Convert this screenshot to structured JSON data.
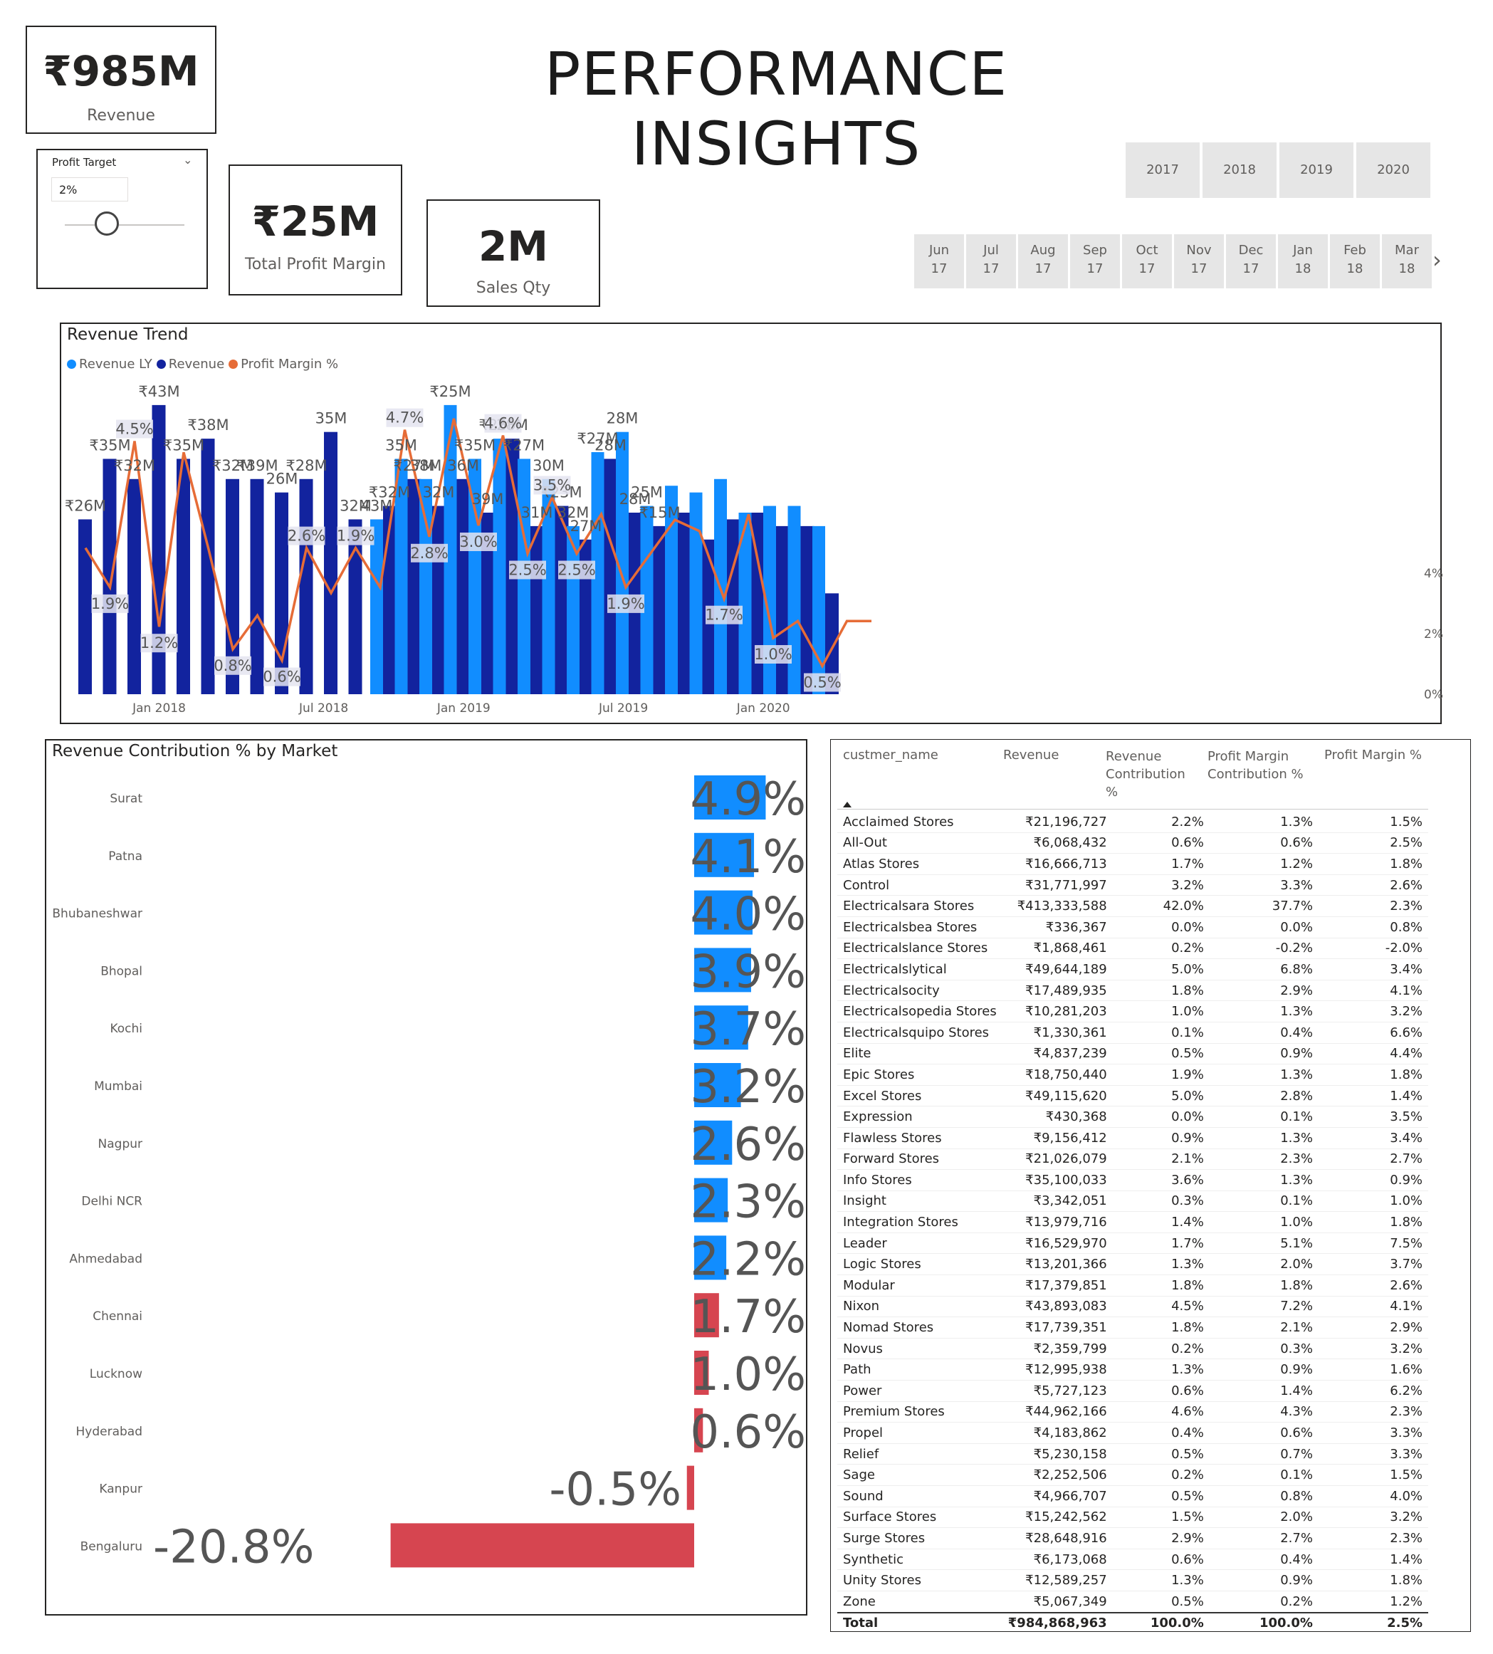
{
  "title": "PERFORMANCE INSIGHTS",
  "kpis": {
    "revenue": {
      "value": "₹985M",
      "label": "Revenue"
    },
    "profit_margin": {
      "value": "₹25M",
      "label": "Total Profit Margin"
    },
    "sales_qty": {
      "value": "2M",
      "label": "Sales Qty"
    }
  },
  "profit_target": {
    "label": "Profit Target",
    "value": "2%",
    "slider_fraction": 0.35
  },
  "year_slicer": [
    "2017",
    "2018",
    "2019",
    "2020"
  ],
  "month_slicer": [
    {
      "m": "Jun",
      "y": "17"
    },
    {
      "m": "Jul",
      "y": "17"
    },
    {
      "m": "Aug",
      "y": "17"
    },
    {
      "m": "Sep",
      "y": "17"
    },
    {
      "m": "Oct",
      "y": "17"
    },
    {
      "m": "Nov",
      "y": "17"
    },
    {
      "m": "Dec",
      "y": "17"
    },
    {
      "m": "Jan",
      "y": "18"
    },
    {
      "m": "Feb",
      "y": "18"
    },
    {
      "m": "Mar",
      "y": "18"
    }
  ],
  "trend": {
    "title": "Revenue Trend",
    "legend": [
      {
        "name": "Revenue LY",
        "color": "#118dff"
      },
      {
        "name": "Revenue",
        "color": "#12239e"
      },
      {
        "name": "Profit Margin %",
        "color": "#e66c37"
      }
    ],
    "x_ticks": [
      "Jan 2018",
      "Jul 2018",
      "Jan 2019",
      "Jul 2019",
      "Jan 2020"
    ],
    "y2_ticks": [
      "4%",
      "2%",
      "0%"
    ]
  },
  "chart_data": [
    {
      "type": "bar+line",
      "title": "Revenue Trend",
      "categories": [
        "2017-10",
        "2017-11",
        "2017-12",
        "2018-01",
        "2018-02",
        "2018-03",
        "2018-04",
        "2018-05",
        "2018-06",
        "2018-07",
        "2018-08",
        "2018-09",
        "2018-10",
        "2018-11",
        "2018-12",
        "2019-01",
        "2019-02",
        "2019-03",
        "2019-04",
        "2019-05",
        "2019-06",
        "2019-07",
        "2019-08",
        "2019-09",
        "2019-10",
        "2019-11",
        "2019-12",
        "2020-01",
        "2020-02",
        "2020-03",
        "2020-04",
        "2020-05",
        "2020-06"
      ],
      "series": [
        {
          "name": "Revenue LY",
          "values": [
            null,
            null,
            null,
            null,
            null,
            null,
            null,
            null,
            null,
            null,
            null,
            null,
            26,
            35,
            32,
            43,
            35,
            38,
            35,
            32,
            25,
            36,
            39,
            28,
            31,
            30,
            32,
            27,
            28,
            28,
            25,
            null,
            null
          ]
        },
        {
          "name": "Revenue",
          "values": [
            26,
            35,
            32,
            43,
            35,
            38,
            32,
            32,
            30,
            32,
            39,
            26,
            28,
            32,
            28,
            32,
            27,
            38,
            25,
            28,
            23,
            35,
            27,
            25,
            27,
            23,
            26,
            27,
            25,
            25,
            15,
            null,
            null
          ]
        },
        {
          "name": "Profit Margin %",
          "values": [
            2.6,
            1.9,
            4.5,
            1.2,
            4.3,
            2.6,
            0.8,
            1.4,
            0.6,
            2.6,
            1.8,
            2.6,
            1.9,
            4.7,
            2.8,
            4.9,
            3.0,
            4.6,
            2.5,
            3.5,
            2.5,
            3.2,
            1.9,
            2.5,
            3.1,
            2.9,
            1.7,
            3.2,
            1.0,
            1.3,
            0.5,
            1.3,
            1.3
          ]
        }
      ],
      "bar_labels": [
        "₹26M",
        "₹35M",
        "₹32M",
        "₹43M",
        "₹35M",
        "₹38M",
        "₹32M",
        "₹39M",
        "26M",
        "₹28M",
        "35M",
        "32M",
        "43M",
        "₹32M",
        "35M",
        "₹27M",
        "38M",
        "32M",
        "₹25M",
        "36M",
        "₹35M",
        "39M",
        "₹25M",
        "28M",
        "₹27M",
        "31M",
        "30M",
        "₹23M",
        "32M",
        "27M",
        "₹27M",
        "28M",
        "28M",
        "28M",
        "25M",
        "₹15M"
      ],
      "line_labels": [
        "1.9%",
        "4.5%",
        "1.2%",
        "0.8%",
        "0.6%",
        "2.6%",
        "1.9%",
        "4.7%",
        "2.8%",
        "3.0%",
        "4.6%",
        "2.5%",
        "3.5%",
        "2.5%",
        "1.9%",
        "1.7%",
        "1.0%",
        "0.5%"
      ],
      "y2_range": [
        0,
        5
      ]
    },
    {
      "type": "bar",
      "title": "Revenue Contribution % by Market",
      "categories": [
        "Surat",
        "Patna",
        "Bhubaneshwar",
        "Bhopal",
        "Kochi",
        "Mumbai",
        "Nagpur",
        "Delhi NCR",
        "Ahmedabad",
        "Chennai",
        "Lucknow",
        "Hyderabad",
        "Kanpur",
        "Bengaluru"
      ],
      "values": [
        4.9,
        4.1,
        4.0,
        3.9,
        3.7,
        3.2,
        2.6,
        2.3,
        2.2,
        1.7,
        1.0,
        0.6,
        -0.5,
        -20.8
      ],
      "labels": [
        "4.9%",
        "4.1%",
        "4.0%",
        "3.9%",
        "3.7%",
        "3.2%",
        "2.6%",
        "2.3%",
        "2.2%",
        "1.7%",
        "1.0%",
        "0.6%",
        "-0.5%",
        "-20.8%"
      ],
      "colors": {
        "high": "#118dff",
        "low": "#d64550"
      }
    }
  ],
  "table": {
    "headers": [
      "custmer_name",
      "Revenue",
      "Revenue Contribution %",
      "Profit Margin Contribution %",
      "Profit Margin %"
    ],
    "rows": [
      [
        "Acclaimed Stores",
        "₹21,196,727",
        "2.2%",
        "1.3%",
        "1.5%"
      ],
      [
        "All-Out",
        "₹6,068,432",
        "0.6%",
        "0.6%",
        "2.5%"
      ],
      [
        "Atlas Stores",
        "₹16,666,713",
        "1.7%",
        "1.2%",
        "1.8%"
      ],
      [
        "Control",
        "₹31,771,997",
        "3.2%",
        "3.3%",
        "2.6%"
      ],
      [
        "Electricalsara Stores",
        "₹413,333,588",
        "42.0%",
        "37.7%",
        "2.3%"
      ],
      [
        "Electricalsbea Stores",
        "₹336,367",
        "0.0%",
        "0.0%",
        "0.8%"
      ],
      [
        "Electricalslance Stores",
        "₹1,868,461",
        "0.2%",
        "-0.2%",
        "-2.0%"
      ],
      [
        "Electricalslytical",
        "₹49,644,189",
        "5.0%",
        "6.8%",
        "3.4%"
      ],
      [
        "Electricalsocity",
        "₹17,489,935",
        "1.8%",
        "2.9%",
        "4.1%"
      ],
      [
        "Electricalsopedia Stores",
        "₹10,281,203",
        "1.0%",
        "1.3%",
        "3.2%"
      ],
      [
        "Electricalsquipo Stores",
        "₹1,330,361",
        "0.1%",
        "0.4%",
        "6.6%"
      ],
      [
        "Elite",
        "₹4,837,239",
        "0.5%",
        "0.9%",
        "4.4%"
      ],
      [
        "Epic Stores",
        "₹18,750,440",
        "1.9%",
        "1.3%",
        "1.8%"
      ],
      [
        "Excel Stores",
        "₹49,115,620",
        "5.0%",
        "2.8%",
        "1.4%"
      ],
      [
        "Expression",
        "₹430,368",
        "0.0%",
        "0.1%",
        "3.5%"
      ],
      [
        "Flawless Stores",
        "₹9,156,412",
        "0.9%",
        "1.3%",
        "3.4%"
      ],
      [
        "Forward Stores",
        "₹21,026,079",
        "2.1%",
        "2.3%",
        "2.7%"
      ],
      [
        "Info Stores",
        "₹35,100,033",
        "3.6%",
        "1.3%",
        "0.9%"
      ],
      [
        "Insight",
        "₹3,342,051",
        "0.3%",
        "0.1%",
        "1.0%"
      ],
      [
        "Integration Stores",
        "₹13,979,716",
        "1.4%",
        "1.0%",
        "1.8%"
      ],
      [
        "Leader",
        "₹16,529,970",
        "1.7%",
        "5.1%",
        "7.5%"
      ],
      [
        "Logic Stores",
        "₹13,201,366",
        "1.3%",
        "2.0%",
        "3.7%"
      ],
      [
        "Modular",
        "₹17,379,851",
        "1.8%",
        "1.8%",
        "2.6%"
      ],
      [
        "Nixon",
        "₹43,893,083",
        "4.5%",
        "7.2%",
        "4.1%"
      ],
      [
        "Nomad Stores",
        "₹17,739,351",
        "1.8%",
        "2.1%",
        "2.9%"
      ],
      [
        "Novus",
        "₹2,359,799",
        "0.2%",
        "0.3%",
        "3.2%"
      ],
      [
        "Path",
        "₹12,995,938",
        "1.3%",
        "0.9%",
        "1.6%"
      ],
      [
        "Power",
        "₹5,727,123",
        "0.6%",
        "1.4%",
        "6.2%"
      ],
      [
        "Premium Stores",
        "₹44,962,166",
        "4.6%",
        "4.3%",
        "2.3%"
      ],
      [
        "Propel",
        "₹4,183,862",
        "0.4%",
        "0.6%",
        "3.3%"
      ],
      [
        "Relief",
        "₹5,230,158",
        "0.5%",
        "0.7%",
        "3.3%"
      ],
      [
        "Sage",
        "₹2,252,506",
        "0.2%",
        "0.1%",
        "1.5%"
      ],
      [
        "Sound",
        "₹4,966,707",
        "0.5%",
        "0.8%",
        "4.0%"
      ],
      [
        "Surface Stores",
        "₹15,242,562",
        "1.5%",
        "2.0%",
        "3.2%"
      ],
      [
        "Surge Stores",
        "₹28,648,916",
        "2.9%",
        "2.7%",
        "2.3%"
      ],
      [
        "Synthetic",
        "₹6,173,068",
        "0.6%",
        "0.4%",
        "1.4%"
      ],
      [
        "Unity Stores",
        "₹12,589,257",
        "1.3%",
        "0.9%",
        "1.8%"
      ],
      [
        "Zone",
        "₹5,067,349",
        "0.5%",
        "0.2%",
        "1.2%"
      ]
    ],
    "total": [
      "Total",
      "₹984,868,963",
      "100.0%",
      "100.0%",
      "2.5%"
    ]
  }
}
